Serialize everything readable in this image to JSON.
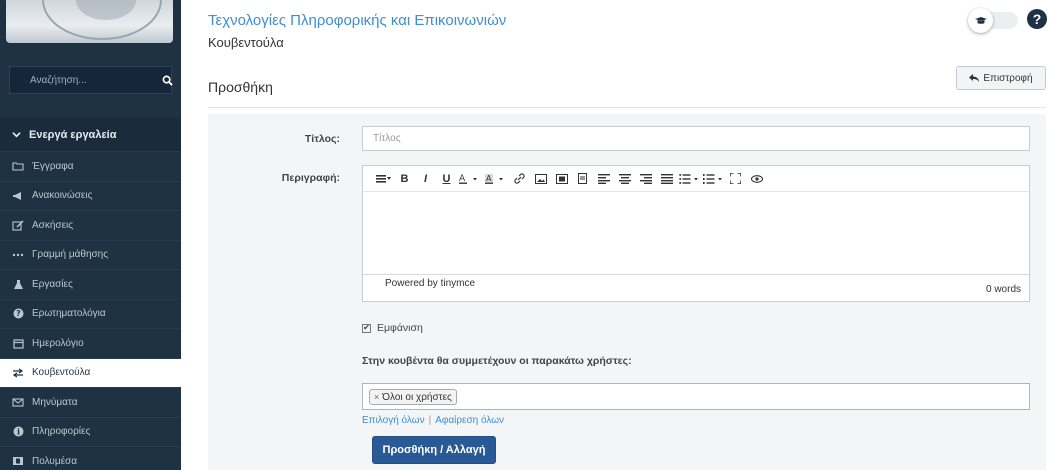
{
  "sidebar": {
    "search_placeholder": "Αναζήτηση...",
    "tools_header": "Ενεργά εργαλεία",
    "items": [
      {
        "label": "Έγγραφα",
        "icon": "folder-icon",
        "active": false
      },
      {
        "label": "Ανακοινώσεις",
        "icon": "bullhorn-icon",
        "active": false
      },
      {
        "label": "Ασκήσεις",
        "icon": "edit-icon",
        "active": false
      },
      {
        "label": "Γραμμή μάθησης",
        "icon": "ellipsis-icon",
        "active": false
      },
      {
        "label": "Εργασίες",
        "icon": "flask-icon",
        "active": false
      },
      {
        "label": "Ερωτηματολόγια",
        "icon": "question-circle-icon",
        "active": false
      },
      {
        "label": "Ημερολόγιο",
        "icon": "calendar-icon",
        "active": false
      },
      {
        "label": "Κουβεντούλα",
        "icon": "exchange-icon",
        "active": true
      },
      {
        "label": "Μηνύματα",
        "icon": "envelope-icon",
        "active": false
      },
      {
        "label": "Πληροφορίες",
        "icon": "info-circle-icon",
        "active": false
      },
      {
        "label": "Πολυμέσα",
        "icon": "film-icon",
        "active": false
      }
    ]
  },
  "header": {
    "course_title": "Τεχνολογίες Πληροφορικής και Επικοινωνιών",
    "course_subtitle": "Κουβεντούλα",
    "page_title": "Προσθήκη",
    "back_label": "Επιστροφή"
  },
  "form": {
    "title_label": "Τίτλος:",
    "title_placeholder": "Τίτλος",
    "description_label": "Περιγραφή:",
    "editor_powered": "Powered by tinymce",
    "editor_wordcount": "0 words",
    "visible_label": "Εμφάνιση",
    "participants_label": "Στην κουβέντα θα συμμετέχουν οι παρακάτω χρήστες:",
    "users_tag": "Όλοι οι χρήστες",
    "select_all": "Επιλογή όλων",
    "remove_all": "Αφαίρεση όλων",
    "submit_label": "Προσθήκη / Αλλαγή"
  },
  "colors": {
    "sidebar_bg": "#1e3244",
    "link": "#3d8fd0",
    "primary_button": "#2a5a96"
  }
}
